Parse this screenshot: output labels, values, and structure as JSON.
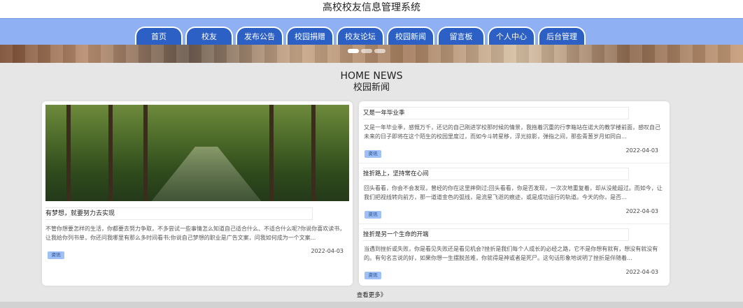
{
  "header": {
    "site_title": "高校校友信息管理系统"
  },
  "nav": {
    "items": [
      {
        "label": "首页"
      },
      {
        "label": "校友"
      },
      {
        "label": "发布公告"
      },
      {
        "label": "校园捐赠"
      },
      {
        "label": "校友论坛"
      },
      {
        "label": "校园新闻"
      },
      {
        "label": "留言板"
      },
      {
        "label": "个人中心"
      },
      {
        "label": "后台管理"
      }
    ]
  },
  "section": {
    "heading_en": "HOME NEWS",
    "heading_cn": "校园新闻"
  },
  "featured": {
    "title": "有梦想，就要努力去实现",
    "summary": "不管你想要怎样的生活，你都要去努力争取，不多尝试一些事情怎么知道自己适合什么、不适合什么呢?你说你喜欢读书，让我给你列书单，你还问我哪里有那么多时间看书;你说自己梦想的职业是广告文案，问我如何成为一个文案...",
    "tag": "资讯",
    "date": "2022-04-03"
  },
  "news_list": [
    {
      "title": "又是一年毕业季",
      "summary": "又是一年毕业季，感慨万千，还记的自己刚进学校那时候的情景，我拖着沉重的行李箱站在诺大的教学楼前面，感叹自己未来的日子即将在这个陌生的校园里度过，而如今斗转星移，浮光掠影，弹指之间，那些青葱岁月如同白...",
      "tag": "资讯",
      "date": "2022-04-03"
    },
    {
      "title": "挫折路上，坚持常在心间",
      "summary": "回头看看，你会不会发现，曾经的你在这里摔倒过;回头看看，你是否发现，一次次地重复着，却从没能超过。而如今，让我们把视线转向前方，那一道道金色的弧线，是流星飞逝的痕迹，或是成功运行的轨道。今天的你，是否...",
      "tag": "资讯",
      "date": "2022-04-03"
    },
    {
      "title": "挫折是另一个生命的开端",
      "summary": "当遇到挫折或失败，你是看见失败还是看见机会?挫折是我们每个人成长的必经之路，它不是你想有就有，想没有就没有的。有句名言说的好，如果你想一生摆脱苦难，你就得是神或者是死尸。这句话形象地说明了挫折是伴随着...",
      "tag": "资讯",
      "date": "2022-04-03"
    }
  ],
  "view_more": "查看更多》"
}
